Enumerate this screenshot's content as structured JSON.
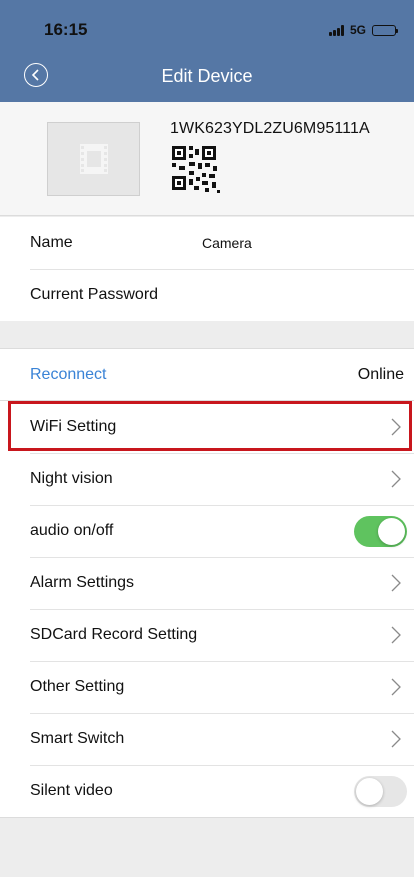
{
  "status_bar": {
    "time": "16:15",
    "network": "5G"
  },
  "nav": {
    "title": "Edit Device"
  },
  "device": {
    "uid": "1WK623YDL2ZU6M95111A"
  },
  "info": {
    "name_label": "Name",
    "name_value": "Camera",
    "password_label": "Current Password"
  },
  "connection": {
    "reconnect_label": "Reconnect",
    "status": "Online",
    "accent": "#3a83d6"
  },
  "settings": [
    {
      "label": "WiFi Setting",
      "control": "chevron"
    },
    {
      "label": "Night vision",
      "control": "chevron"
    },
    {
      "label": "audio on/off",
      "control": "toggle",
      "on": true
    },
    {
      "label": "Alarm Settings",
      "control": "chevron"
    },
    {
      "label": "SDCard Record Setting",
      "control": "chevron"
    },
    {
      "label": "Other Setting",
      "control": "chevron"
    },
    {
      "label": "Smart Switch",
      "control": "chevron"
    },
    {
      "label": "Silent video",
      "control": "toggle",
      "on": false
    }
  ],
  "colors": {
    "nav_bg": "#5577a5",
    "toggle_on": "#5fc35f",
    "highlight": "#c8161d"
  }
}
